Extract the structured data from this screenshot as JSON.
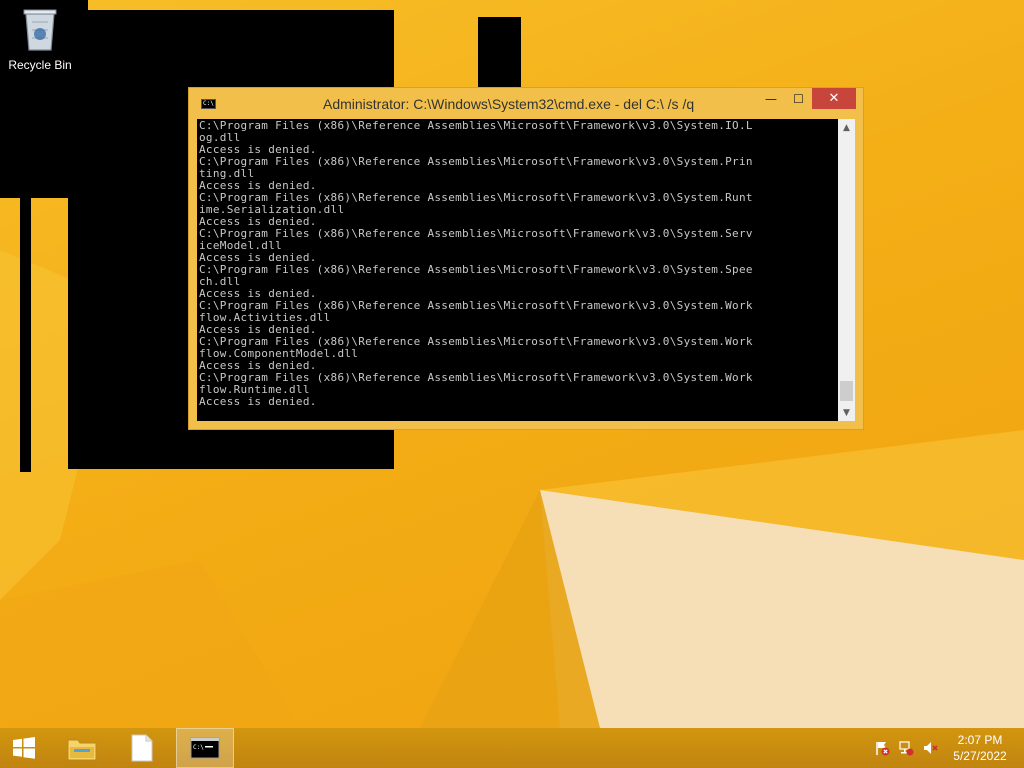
{
  "desktop": {
    "icons": [
      {
        "label": "Recycle Bin",
        "icon": "recycle-bin-icon"
      }
    ]
  },
  "window": {
    "title": "Administrator: C:\\Windows\\System32\\cmd.exe - del  C:\\ /s /q",
    "icon": "cmd-icon",
    "buttons": {
      "minimize": "—",
      "maximize": "☐",
      "close": "✕"
    },
    "console_lines": [
      "C:\\Program Files (x86)\\Reference Assemblies\\Microsoft\\Framework\\v3.0\\System.IO.L",
      "og.dll",
      "Access is denied.",
      "C:\\Program Files (x86)\\Reference Assemblies\\Microsoft\\Framework\\v3.0\\System.Prin",
      "ting.dll",
      "Access is denied.",
      "C:\\Program Files (x86)\\Reference Assemblies\\Microsoft\\Framework\\v3.0\\System.Runt",
      "ime.Serialization.dll",
      "Access is denied.",
      "C:\\Program Files (x86)\\Reference Assemblies\\Microsoft\\Framework\\v3.0\\System.Serv",
      "iceModel.dll",
      "Access is denied.",
      "C:\\Program Files (x86)\\Reference Assemblies\\Microsoft\\Framework\\v3.0\\System.Spee",
      "ch.dll",
      "Access is denied.",
      "C:\\Program Files (x86)\\Reference Assemblies\\Microsoft\\Framework\\v3.0\\System.Work",
      "flow.Activities.dll",
      "Access is denied.",
      "C:\\Program Files (x86)\\Reference Assemblies\\Microsoft\\Framework\\v3.0\\System.Work",
      "flow.ComponentModel.dll",
      "Access is denied.",
      "C:\\Program Files (x86)\\Reference Assemblies\\Microsoft\\Framework\\v3.0\\System.Work",
      "flow.Runtime.dll",
      "Access is denied."
    ],
    "scrollbar": {
      "up_icon": "chevron-up-icon",
      "down_icon": "chevron-down-icon"
    }
  },
  "taskbar": {
    "start_icon": "windows-logo-icon",
    "pinned": [
      {
        "name": "file-explorer",
        "icon": "folder-icon"
      },
      {
        "name": "file",
        "icon": "document-icon"
      },
      {
        "name": "command-prompt",
        "icon": "cmd-icon"
      }
    ],
    "tray": [
      "action-center-flag-icon",
      "network-icon",
      "volume-muted-icon"
    ],
    "clock": {
      "time": "2:07 PM",
      "date": "5/27/2022"
    }
  },
  "colors": {
    "wallpaper": "#f5b31c",
    "window_frame": "#f2c04a",
    "close_button": "#c7453a",
    "console_bg": "#000000",
    "console_text": "#c8c8c8"
  }
}
